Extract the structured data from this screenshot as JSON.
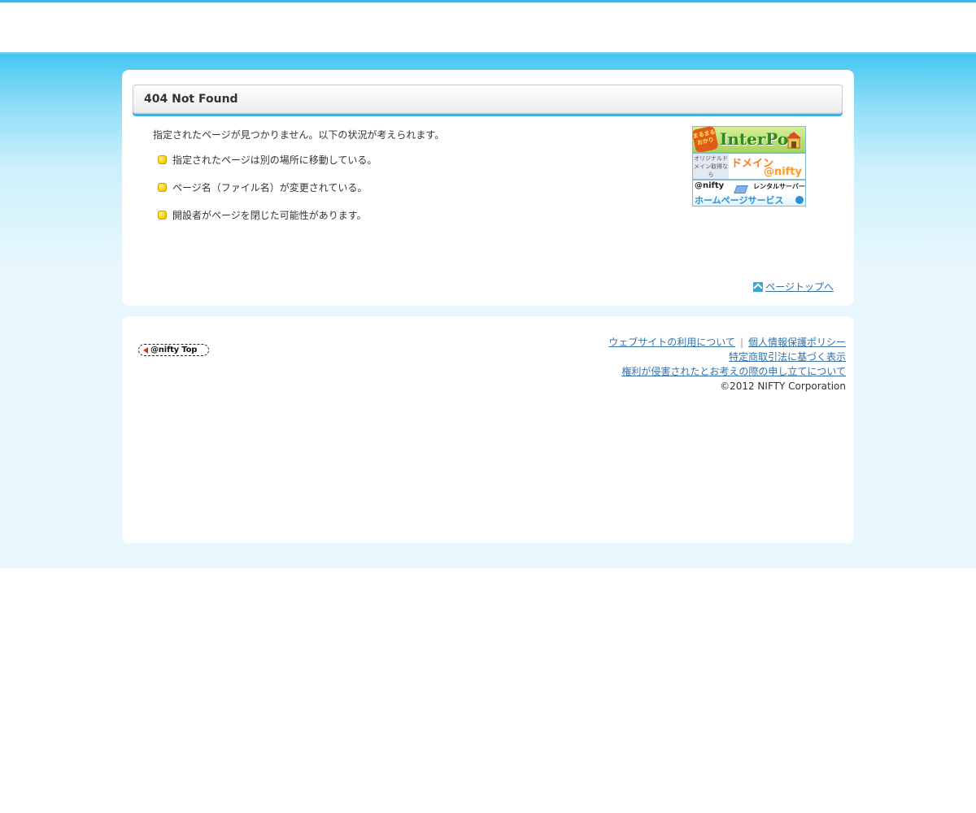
{
  "main": {
    "title": "404 Not Found",
    "intro": "指定されたページが見つかりません。以下の状況が考えられます。",
    "reasons": [
      "指定されたページは別の場所に移動している。",
      "ページ名（ファイル名）が変更されている。",
      "開設者がページを閉じた可能性があります。"
    ],
    "page_top_label": "ページトップへ"
  },
  "banners": {
    "interpot": {
      "tag": "まるまるおかり",
      "brand": "InterPot"
    },
    "domain": {
      "left": "オリジナルドメイン取得なら",
      "headline": "ドメイン",
      "brand": "@nifty"
    },
    "homepage": {
      "brand": "@nifty",
      "sub": "レンタルサーバー",
      "headline": "ホームページサービス"
    }
  },
  "footer": {
    "nifty_top_label": "@nifty Top",
    "links": {
      "website_use": "ウェブサイトの利用について",
      "privacy": "個人情報保護ポリシー",
      "commerce": "特定商取引法に基づく表示",
      "rights": "権利が侵害されたとお考えの際の申し立てについて"
    },
    "separator": "|",
    "copyright": "©2012 NIFTY Corporation"
  }
}
